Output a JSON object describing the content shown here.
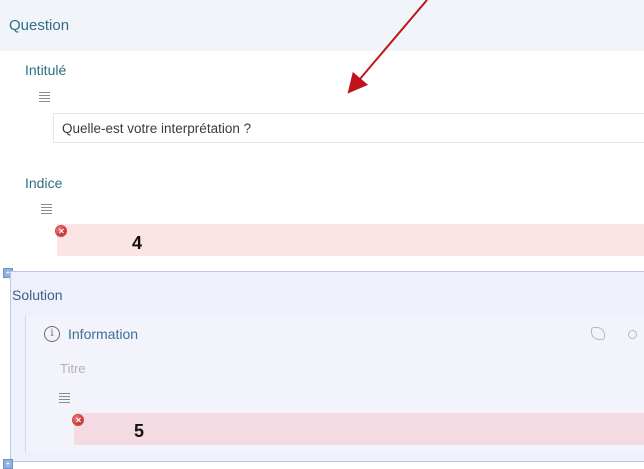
{
  "section": {
    "title": "Question"
  },
  "intitule": {
    "label": "Intitulé",
    "icon": "text-lines-icon",
    "value": "Quelle-est votre interprétation ?"
  },
  "indice": {
    "label": "Indice",
    "icon": "text-lines-icon",
    "error_icon": "error-icon",
    "callout": "4"
  },
  "solution": {
    "label": "Solution",
    "expand_icon": "+",
    "card": {
      "title": "Information",
      "icon": "info-icon",
      "title_placeholder": "Titre",
      "error_icon": "error-icon",
      "callout": "5"
    }
  },
  "bottom": {
    "expand_icon": "+"
  },
  "colors": {
    "accent": "#2f6e86",
    "header_bg": "#f1f4f8",
    "error_bg": "#fbe4e4",
    "arrow": "#c0141c",
    "solution_bg": "#eef0fa"
  }
}
